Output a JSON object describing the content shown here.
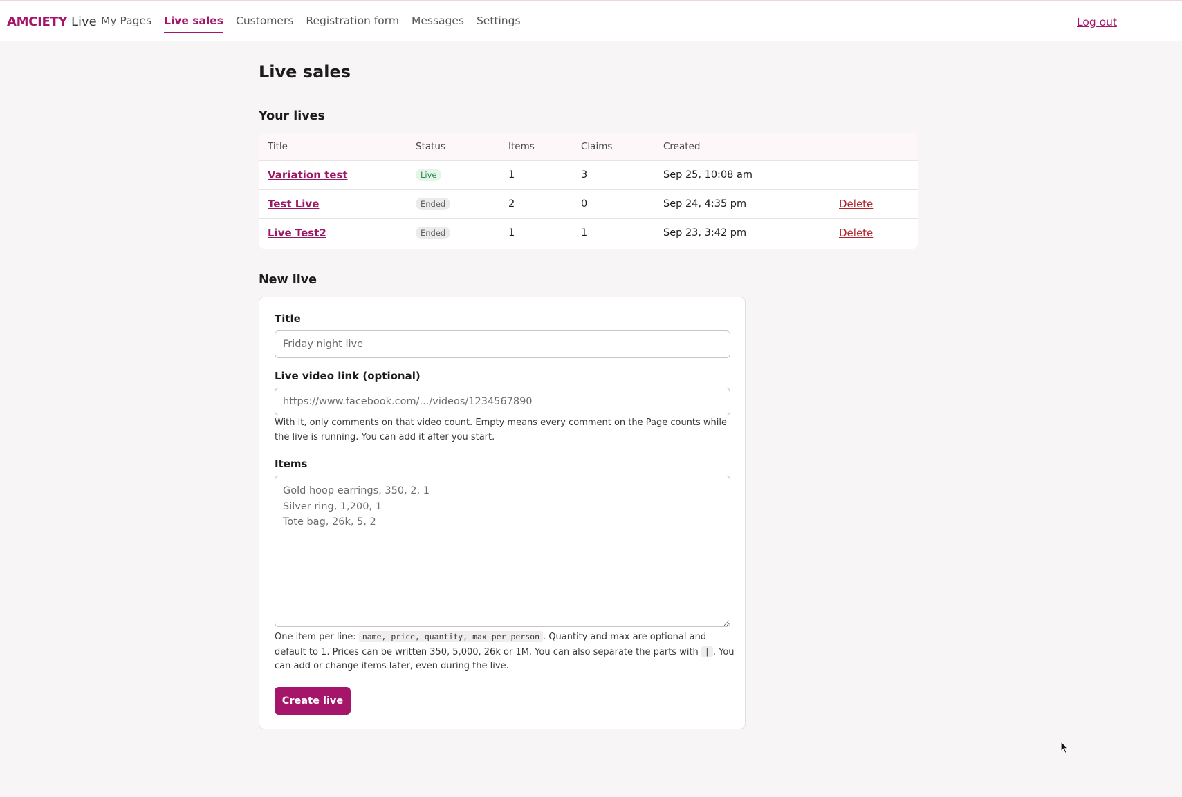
{
  "header": {
    "brand": "AMCIETY",
    "brand_suffix": "Live",
    "nav": [
      {
        "label": "My Pages",
        "active": false
      },
      {
        "label": "Live sales",
        "active": true
      },
      {
        "label": "Customers",
        "active": false
      },
      {
        "label": "Registration form",
        "active": false
      },
      {
        "label": "Messages",
        "active": false
      },
      {
        "label": "Settings",
        "active": false
      }
    ],
    "logout": "Log out"
  },
  "page": {
    "title": "Live sales",
    "lives_heading": "Your lives",
    "new_heading": "New live"
  },
  "lives_table": {
    "columns": [
      "Title",
      "Status",
      "Items",
      "Claims",
      "Created",
      ""
    ],
    "rows": [
      {
        "title": "Variation test",
        "status": "Live",
        "items": "1",
        "claims": "3",
        "created": "Sep 25, 10:08 am",
        "action": ""
      },
      {
        "title": "Test Live",
        "status": "Ended",
        "items": "2",
        "claims": "0",
        "created": "Sep 24, 4:35 pm",
        "action": "Delete"
      },
      {
        "title": "Live Test2",
        "status": "Ended",
        "items": "1",
        "claims": "1",
        "created": "Sep 23, 3:42 pm",
        "action": "Delete"
      }
    ]
  },
  "form": {
    "title_label": "Title",
    "title_placeholder": "Friday night live",
    "video_label": "Live video link (optional)",
    "video_placeholder": "https://www.facebook.com/.../videos/1234567890",
    "video_help": "With it, only comments on that video count. Empty means every comment on the Page counts while the live is running. You can add it after you start.",
    "items_label": "Items",
    "items_placeholder": "Gold hoop earrings, 350, 2, 1\nSilver ring, 1,200, 1\nTote bag, 26k, 5, 2",
    "items_help_1": "One item per line:",
    "items_help_code": "name, price, quantity, max per person",
    "items_help_2": ". Quantity and max are optional and default to 1. Prices can be written 350, 5,000, 26k or 1M. You can also separate the parts with",
    "items_help_pipe": "|",
    "items_help_3": ". You can add or change items later, even during the live.",
    "submit": "Create live"
  },
  "colors": {
    "accent": "#a5166a",
    "live_badge_bg": "#e4f4e9",
    "ended_badge_bg": "#ecebec",
    "delete": "#b0262f"
  }
}
